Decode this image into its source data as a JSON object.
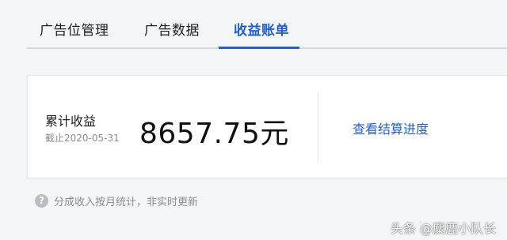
{
  "tabs": [
    {
      "label": "广告位管理",
      "active": false
    },
    {
      "label": "广告数据",
      "active": false
    },
    {
      "label": "收益账单",
      "active": true
    }
  ],
  "colors": {
    "accent": "#2260c7",
    "background": "#f4f5f7",
    "card": "#ffffff"
  },
  "earnings": {
    "label": "累计收益",
    "as_of": "截止2020-05-31",
    "amount": "8657.75元",
    "progress_link": "查看结算进度"
  },
  "note": {
    "icon": "question-icon",
    "text": "分成收入按月统计，非实时更新"
  },
  "watermark": "头条 @麋鹿小队长"
}
